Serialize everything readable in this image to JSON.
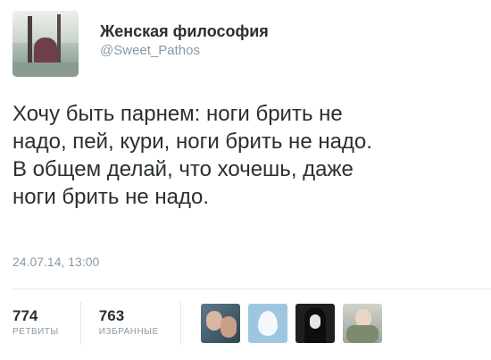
{
  "author": {
    "name": "Женская философия",
    "handle": "@Sweet_Pathos"
  },
  "tweet": {
    "lines": [
      "Хочу быть парнем: ноги брить не",
      "надо, пей, кури, ноги брить не надо.",
      "В общем делай, что хочешь, даже",
      "ноги брить не надо."
    ],
    "timestamp": "24.07.14, 13:00"
  },
  "stats": {
    "retweets": {
      "count": "774",
      "label": "РЕТВИТЫ"
    },
    "favorites": {
      "count": "763",
      "label": "ИЗБРАННЫЕ"
    }
  },
  "icons": {
    "author_avatar": "profile-photo-icon",
    "favoriters": [
      "user-avatar-icon",
      "default-egg-avatar-icon",
      "user-avatar-icon",
      "user-avatar-icon"
    ]
  },
  "colors": {
    "text": "#292f33",
    "muted": "#8899a6",
    "divider": "#e1e8ed"
  }
}
